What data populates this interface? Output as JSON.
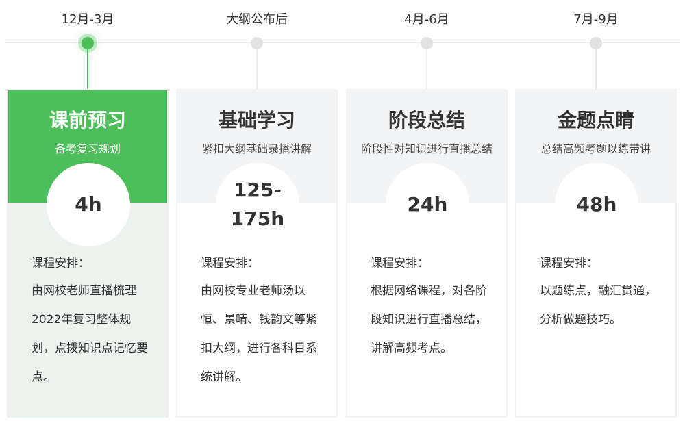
{
  "stages": [
    {
      "date": "12月-3月",
      "title": "课前预习",
      "subtitle": "备考复习规划",
      "hours": "4h",
      "schedule_label": "课程安排：",
      "schedule_text": "由网校老师直播梳理2022年复习整体规划，点拨知识点记忆要点。"
    },
    {
      "date": "大纲公布后",
      "title": "基础学习",
      "subtitle": "紧扣大纲基础录播讲解",
      "hours": "125-175h",
      "schedule_label": "课程安排：",
      "schedule_text": "由网校专业老师汤以恒、景晴、钱韵文等紧扣大纲，进行各科目系统讲解。"
    },
    {
      "date": "4月-6月",
      "title": "阶段总结",
      "subtitle": "阶段性对知识进行直播总结",
      "hours": "24h",
      "schedule_label": "课程安排：",
      "schedule_text": "根据网络课程，对各阶段知识进行直播总结，讲解高频考点。"
    },
    {
      "date": "7月-9月",
      "title": "金题点睛",
      "subtitle": "总结高频考题以练带讲",
      "hours": "48h",
      "schedule_label": "课程安排：",
      "schedule_text": "以题练点，融汇贯通，分析做题技巧。"
    }
  ],
  "colors": {
    "accent": "#4cbe5a",
    "inactive_dot": "#e2e2e2",
    "card_head": "#f3f4f5"
  }
}
